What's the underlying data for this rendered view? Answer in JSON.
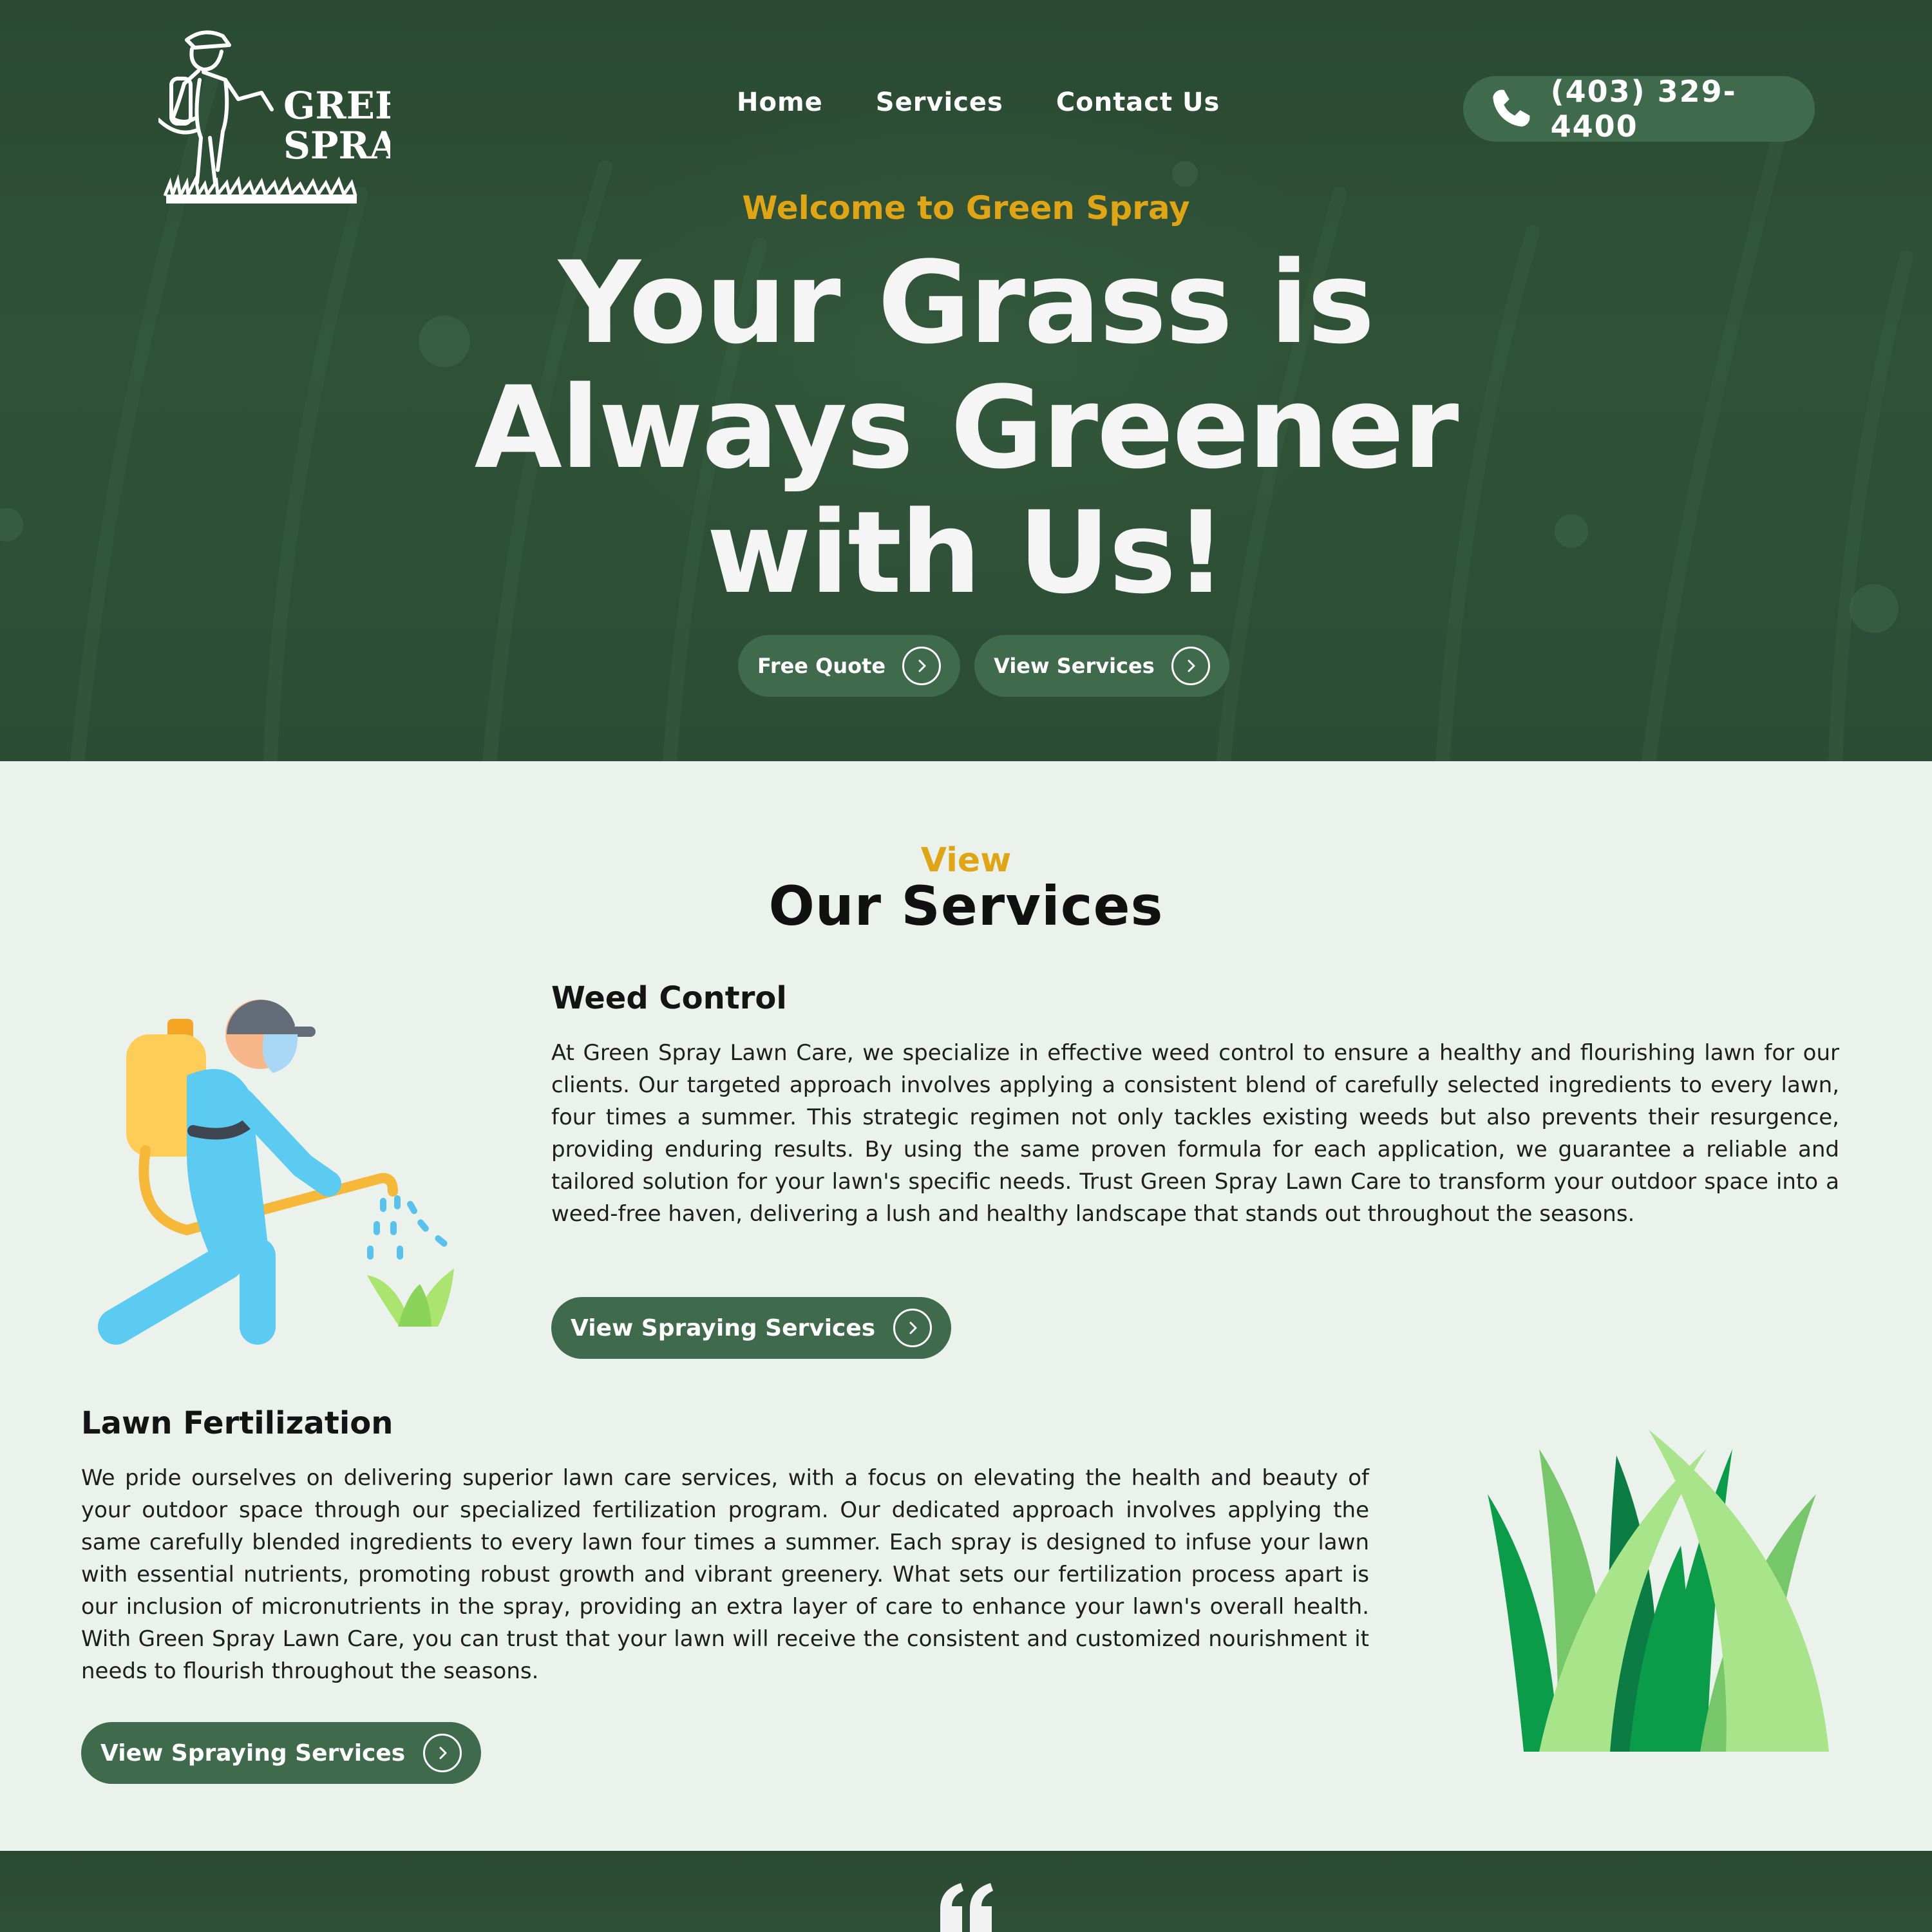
{
  "logo": {
    "line1": "GREEN",
    "line2": "SPRAY"
  },
  "nav": {
    "items": [
      {
        "label": "Home"
      },
      {
        "label": "Services"
      },
      {
        "label": "Contact Us"
      }
    ]
  },
  "phone": {
    "number": "(403) 329-4400",
    "icon": "phone-icon"
  },
  "hero": {
    "eyebrow": "Welcome to Green Spray",
    "headline_lines": [
      "Your Grass is",
      "Always Greener",
      "with Us!"
    ],
    "buttons": [
      {
        "label": "Free Quote",
        "icon": "chevron-right-circle-icon"
      },
      {
        "label": "View Services",
        "icon": "chevron-right-circle-icon"
      }
    ]
  },
  "services": {
    "eyebrow": "View",
    "title": "Our Services",
    "items": [
      {
        "title": "Weed Control",
        "body": "At Green Spray Lawn Care, we specialize in effective weed control to ensure a healthy and flourishing lawn for our clients. Our targeted approach involves applying a consistent blend of carefully selected ingredients to every lawn, four times a summer. This strategic regimen not only tackles existing weeds but also prevents their resurgence, providing enduring results. By using the same proven formula for each application, we guarantee a reliable and tailored solution for your lawn's specific needs. Trust Green Spray Lawn Care to transform your outdoor space into a weed-free haven, delivering a lush and healthy landscape that stands out throughout the seasons.",
        "button": "View Spraying Services",
        "illustration": "lawn-sprayer-worker-illustration"
      },
      {
        "title": "Lawn Fertilization",
        "body": "We pride ourselves on delivering superior lawn care services, with a focus on elevating the health and beauty of your outdoor space through our specialized fertilization program. Our dedicated approach involves applying the same carefully blended ingredients to every lawn four times a summer. Each spray is designed to infuse your lawn with essential nutrients, promoting robust growth and vibrant greenery. What sets our fertilization process apart is our inclusion of micronutrients in the spray, providing an extra layer of care to enhance your lawn's overall health. With Green Spray Lawn Care, you can trust that your lawn will receive the consistent and customized nourishment it needs to flourish throughout the seasons.",
        "button": "View Spraying Services",
        "illustration": "grass-blades-illustration"
      }
    ]
  },
  "testimonial": {
    "icon": "quote-icon"
  },
  "colors": {
    "hero_bg": "#2d4f36",
    "button_bg": "#3f6a4b",
    "accent_gold": "#e0a514",
    "page_bg": "#ebf2ec"
  }
}
